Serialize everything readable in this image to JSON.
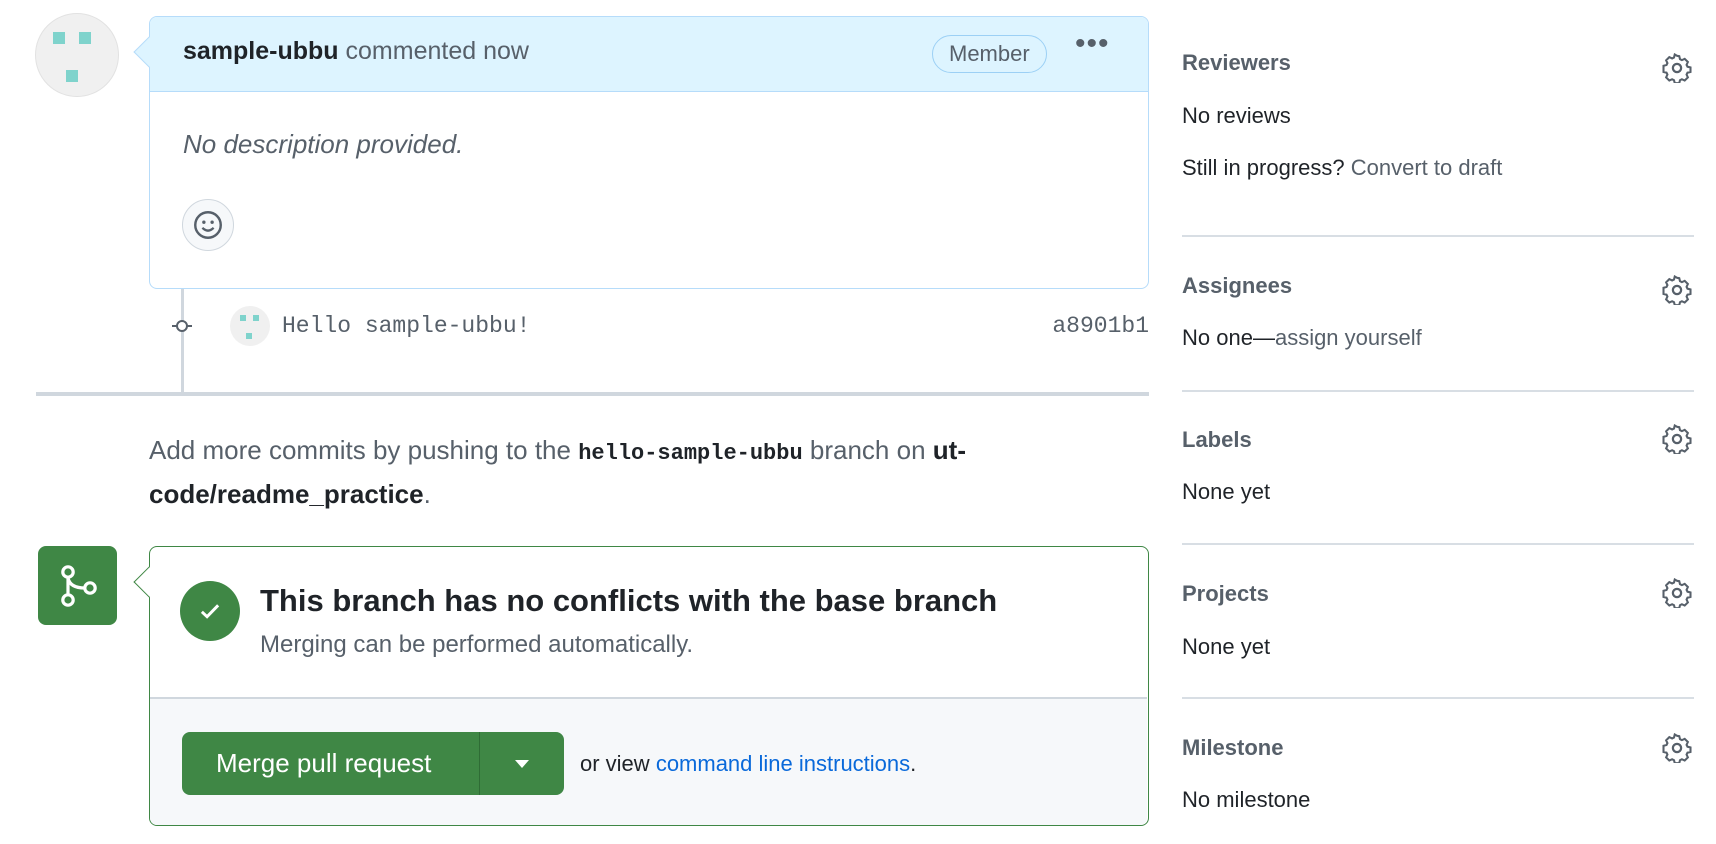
{
  "comment": {
    "author": "sample-ubbu",
    "action": "commented now",
    "badge": "Member",
    "body": "No description provided."
  },
  "commit": {
    "message": "Hello sample-ubbu!",
    "sha": "a8901b1"
  },
  "push_hint": {
    "prefix": "Add more commits by pushing to the",
    "branch": "hello-sample-ubbu",
    "middle": "branch on",
    "repo": "ut-code/readme_practice",
    "suffix": "."
  },
  "merge": {
    "title": "This branch has no conflicts with the base branch",
    "subtitle": "Merging can be performed automatically.",
    "button": "Merge pull request",
    "or_view": "or view",
    "link": "command line instructions",
    "link_suffix": "."
  },
  "sidebar": {
    "reviewers": {
      "heading": "Reviewers",
      "value": "No reviews",
      "progress_q": "Still in progress?",
      "convert": "Convert to draft"
    },
    "assignees": {
      "heading": "Assignees",
      "value": "No one—",
      "assign": "assign yourself"
    },
    "labels": {
      "heading": "Labels",
      "value": "None yet"
    },
    "projects": {
      "heading": "Projects",
      "value": "None yet"
    },
    "milestone": {
      "heading": "Milestone",
      "value": "No milestone"
    }
  },
  "colors": {
    "green": "#3f8745",
    "link": "#0969da",
    "header_bg": "#ddf4ff"
  }
}
